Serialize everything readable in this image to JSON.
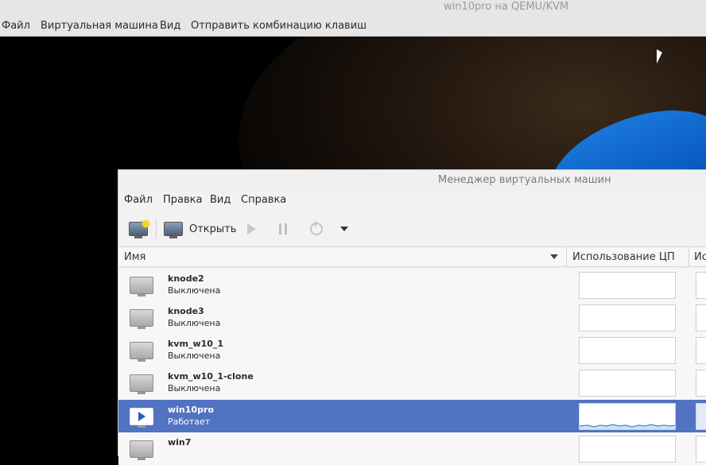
{
  "outer_window": {
    "title": "win10pro на QEMU/KVM",
    "menu": [
      "Файл",
      "Виртуальная машина",
      "Вид",
      "Отправить комбинацию клавиш"
    ]
  },
  "manager": {
    "title": "Менеджер виртуальных машин",
    "menu": [
      "Файл",
      "Правка",
      "Вид",
      "Справка"
    ],
    "toolbar": {
      "open_label": "Открыть"
    },
    "columns": {
      "name": "Имя",
      "cpu": "Использование ЦП",
      "next": "Ис"
    },
    "vms": [
      {
        "name": "knode2",
        "status": "Выключена"
      },
      {
        "name": "knode3",
        "status": "Выключена"
      },
      {
        "name": "kvm_w10_1",
        "status": "Выключена"
      },
      {
        "name": "kvm_w10_1-clone",
        "status": "Выключена"
      },
      {
        "name": "win10pro",
        "status": "Работает",
        "selected": true
      },
      {
        "name": "win7",
        "status": ""
      }
    ]
  },
  "colors": {
    "selection": "#5272c2",
    "cpu_graph": "#3d8ad0"
  },
  "icons": [
    "new-vm-icon",
    "monitor-icon",
    "play-icon",
    "pause-icon",
    "power-icon",
    "dropdown-arrow-icon"
  ]
}
